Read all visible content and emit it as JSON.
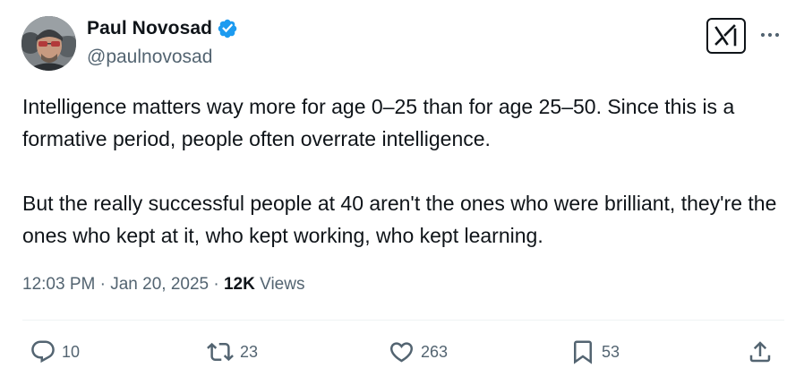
{
  "author": {
    "display_name": "Paul Novosad",
    "handle": "@paulnovosad",
    "avatar_icon": "profile-photo",
    "verified_icon": "verified-badge-icon",
    "verified_color": "#1d9bf0"
  },
  "header": {
    "grok_icon": "x-grok-logo-icon",
    "more_icon": "more-dots-icon"
  },
  "tweet": {
    "paragraph_1": "Intelligence matters way more for age 0–25 than for age 25–50. Since this is a formative period, people often overrate intelligence.",
    "paragraph_2": "But the really successful people at 40 aren't the ones who were brilliant, they're the ones who kept at it, who kept working, who kept learning."
  },
  "meta": {
    "time": "12:03 PM",
    "separator": "·",
    "date": "Jan 20, 2025",
    "views_count": "12K",
    "views_label": "Views"
  },
  "actions": {
    "replies": {
      "icon": "reply-icon",
      "count": "10"
    },
    "reposts": {
      "icon": "repost-icon",
      "count": "23"
    },
    "likes": {
      "icon": "like-icon",
      "count": "263"
    },
    "bookmarks": {
      "icon": "bookmark-icon",
      "count": "53"
    },
    "share": {
      "icon": "share-icon"
    }
  },
  "colors": {
    "text": "#0f1419",
    "secondary": "#536471",
    "divider": "#eff3f4"
  }
}
